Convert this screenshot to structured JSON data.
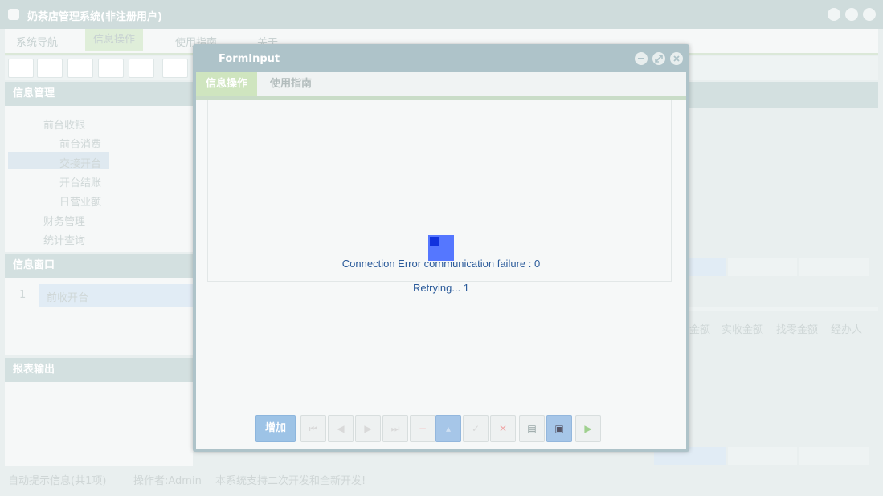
{
  "app": {
    "title": "奶茶店管理系统(非注册用户)",
    "menu": [
      "系统导航",
      "信息操作",
      "使用指南",
      "关于"
    ],
    "panels": {
      "info_management": "信息管理",
      "info_window": "信息窗口",
      "report_output": "报表输出"
    },
    "tree": [
      {
        "label": "前台收银"
      },
      {
        "label": "前台消费"
      },
      {
        "label": "交接开台"
      },
      {
        "label": "开台结账"
      },
      {
        "label": "日营业额"
      },
      {
        "label": "财务管理"
      },
      {
        "label": "统计查询"
      }
    ],
    "info_window_row": {
      "index": "1",
      "label": "前收开台"
    },
    "right_columns": [
      "金额",
      "实收金额",
      "找零金额",
      "经办人"
    ],
    "status": {
      "hint": "自动提示信息(共1项)",
      "operator": "操作者:Admin",
      "note": "本系统支持二次开发和全新开发!"
    }
  },
  "dialog": {
    "title": "FormInput",
    "tabs": [
      "信息操作",
      "使用指南"
    ],
    "error_line": "Connection Error communication failure : 0",
    "retry_line": "Retrying... 1",
    "add_button": "增加",
    "colors": {
      "accent": "#aec3c9",
      "spinner": "#5577ff",
      "text": "#2a5a9a",
      "tab_active": "#cfe5bf"
    }
  }
}
